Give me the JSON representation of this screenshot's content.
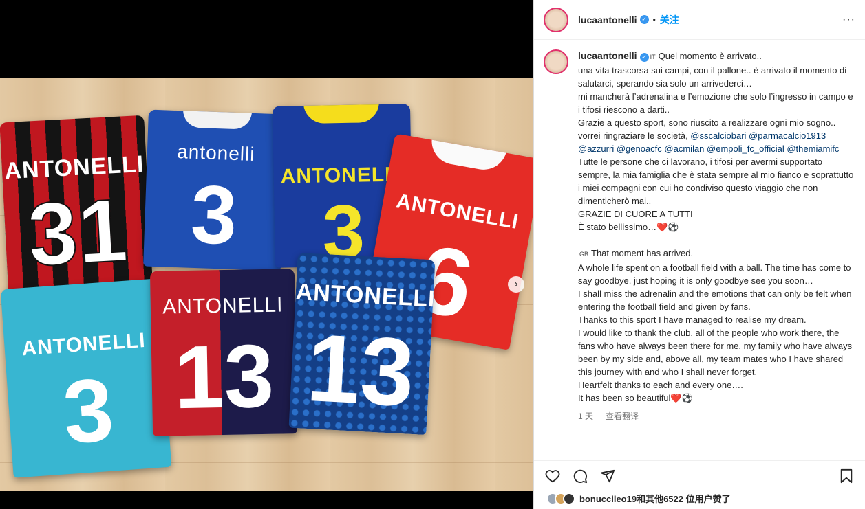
{
  "post": {
    "username": "lucaantonelli",
    "dot": "•",
    "follow_label": "关注",
    "more_label": "···"
  },
  "photo": {
    "jerseys": [
      {
        "key": "milan",
        "name": "ANTONELLI",
        "number": "31"
      },
      {
        "key": "italy",
        "name": "antonelli",
        "number": "3"
      },
      {
        "key": "parma",
        "name": "ANTONELLI",
        "number": "3"
      },
      {
        "key": "bari",
        "name": "ANTONELLI",
        "number": "6"
      },
      {
        "key": "gk",
        "name": "ANTONELLI",
        "number": "3"
      },
      {
        "key": "genoa",
        "name": "ANTONELLI",
        "number": "13"
      },
      {
        "key": "empoli",
        "name": "ANTONELLI",
        "number": "13"
      }
    ],
    "next_label": "›"
  },
  "caption": {
    "username": "lucaantonelli",
    "flag_it": "IT",
    "it_text": "Quel momento è arrivato..\nuna vita trascorsa sui campi, con il pallone.. è arrivato il momento di salutarci, sperando sia solo un arrivederci…\nmi mancherà l’adrenalina e l’emozione che solo l’ingresso in campo e i tifosi riescono a darti..\nGrazie a questo sport, sono riuscito a realizzare ogni mio sogno..\nvorrei ringraziare le società, ",
    "mentions_1": [
      "@sscalciobari",
      "@parmacalcio1913",
      "@azzurri",
      "@genoacfc",
      "@acmilan",
      "@empoli_fc_official",
      "@themiamifc"
    ],
    "it_text_2": "Tutte le persone che ci lavorano, i tifosi per avermi supportato sempre, la mia famiglia che è stata sempre al mio fianco e soprattutto i miei compagni con cui ho condiviso questo viaggio che non dimenticherò mai..\nGRAZIE DI CUORE A TUTTI\nÈ stato bellissimo…❤️⚽",
    "flag_gb": "GB",
    "en_text": "That moment has arrived.\nA whole life spent on a football field with a ball. The time has come to say goodbye, just hoping it is only goodbye see you soon…\nI shall miss the adrenalin and the emotions that can only be felt when entering the football field and given by fans.\nThanks to this sport I have managed to realise my dream.\nI would like to thank the club, all of the people who work there, the fans who have always been there for me, my family who have always been by my side and, above all, my team mates who I have shared this journey with and who I shall never forget.\nHeartfelt thanks to each and every one….\nIt has been so beautiful❤️⚽",
    "time": "1 天",
    "translate": "查看翻译"
  },
  "likes": {
    "text": "bonuccileo19和其他6522 位用户赞了"
  },
  "icons": [
    "heart-icon",
    "comment-icon",
    "share-icon",
    "bookmark-icon",
    "verified-icon",
    "chevron-right-icon"
  ]
}
